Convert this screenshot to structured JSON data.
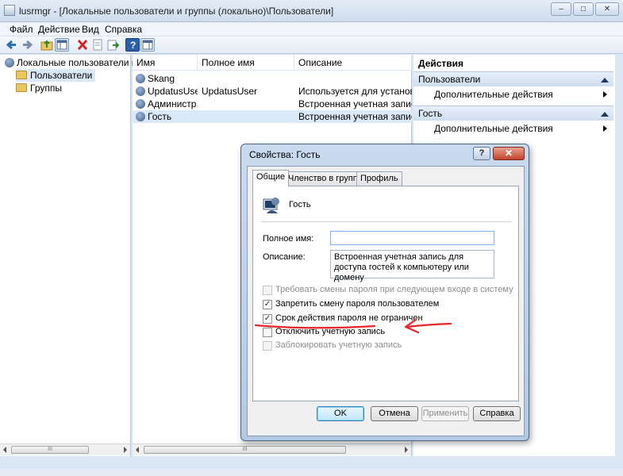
{
  "window": {
    "title": "lusrmgr - [Локальные пользователи и группы (локально)\\Пользователи]",
    "controls": [
      "–",
      "□",
      "✕"
    ]
  },
  "menu": [
    "Файл",
    "Действие",
    "Вид",
    "Справка"
  ],
  "tree": {
    "root": "Локальные пользователи и гру",
    "items": [
      "Пользователи",
      "Группы"
    ]
  },
  "list": {
    "columns": [
      "Имя",
      "Полное имя",
      "Описание"
    ],
    "rows": [
      {
        "name": "Skang",
        "full_name": "",
        "description": ""
      },
      {
        "name": "UpdatusUser",
        "full_name": "UpdatusUser",
        "description": "Используется для установки об"
      },
      {
        "name": "Администр...",
        "full_name": "",
        "description": "Встроенная учетная запись адм"
      },
      {
        "name": "Гость",
        "full_name": "",
        "description": "Встроенная учетная запись для"
      }
    ]
  },
  "actions": {
    "header": "Действия",
    "sections": [
      {
        "title": "Пользователи",
        "item": "Дополнительные действия"
      },
      {
        "title": "Гость",
        "item": "Дополнительные действия"
      }
    ]
  },
  "scroll_glyph": "III",
  "dialog": {
    "title": "Свойства: Гость",
    "help_glyph": "?",
    "close_glyph": "✕",
    "tabs": [
      "Общие",
      "Членство в группах",
      "Профиль"
    ],
    "user_name": "Гость",
    "full_name_label": "Полное имя:",
    "full_name_value": "",
    "description_label": "Описание:",
    "description_value": "Встроенная учетная запись для доступа гостей к компьютеру или домену",
    "checkboxes": [
      {
        "label": "Требовать смены пароля при следующем входе в систему",
        "checked": false,
        "enabled": false
      },
      {
        "label": "Запретить смену пароля пользователем",
        "checked": true,
        "enabled": true
      },
      {
        "label": "Срок действия пароля не ограничен",
        "checked": true,
        "enabled": true
      },
      {
        "label": "Отключить учетную запись",
        "checked": false,
        "enabled": true
      },
      {
        "label": "Заблокировать учетную запись",
        "checked": false,
        "enabled": false
      }
    ],
    "buttons": {
      "ok": "OK",
      "cancel": "Отмена",
      "apply": "Применить",
      "help": "Справка"
    }
  },
  "colors": {
    "annotation": "#e8242a",
    "selection": "#dbe8f8",
    "accent": "#3c7fb1"
  }
}
